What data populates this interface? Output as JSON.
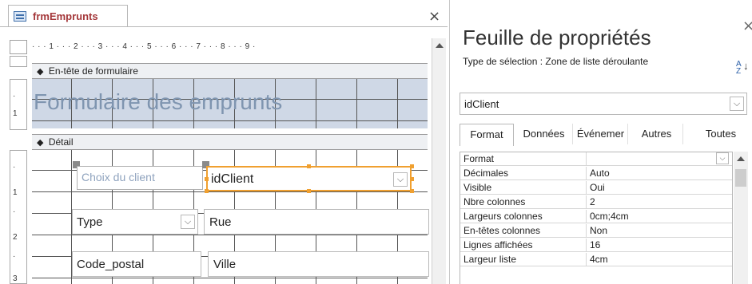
{
  "document": {
    "tab_title": "frmEmprunts",
    "close_symbol": "×"
  },
  "ruler": {
    "marks": "· · · 1 · · · 2 · · · 3 · · · 4 · · · 5 · · · 6 · · · 7 · · · 8 · · · 9 ·"
  },
  "sections": {
    "header_label": "En-tête de formulaire",
    "detail_label": "Détail",
    "arrow": "◆"
  },
  "form": {
    "title": "Formulaire des emprunts",
    "controls": {
      "client_label": "Choix du client",
      "client_combo": "idClient",
      "type": "Type",
      "rue": "Rue",
      "code_postal": "Code_postal",
      "ville": "Ville"
    }
  },
  "vertical_ruler": {
    "marks": [
      "·",
      "1",
      "·",
      "1",
      "·",
      "2",
      "·",
      "3"
    ]
  },
  "property_sheet": {
    "title": "Feuille de propriétés",
    "close_symbol": "×",
    "selection_type": "Type de sélection :  Zone de liste déroulante",
    "sort_icon_top": "A",
    "sort_icon_bottom": "Z",
    "sort_icon_arrow": "↓",
    "selected_object": "idClient",
    "tabs": [
      "Format",
      "Données",
      "Événemer",
      "Autres",
      "Toutes"
    ],
    "properties": [
      {
        "name": "Format",
        "value": ""
      },
      {
        "name": "Décimales",
        "value": "Auto"
      },
      {
        "name": "Visible",
        "value": "Oui"
      },
      {
        "name": "Nbre colonnes",
        "value": "2"
      },
      {
        "name": "Largeurs colonnes",
        "value": "0cm;4cm"
      },
      {
        "name": "En-têtes colonnes",
        "value": "Non"
      },
      {
        "name": "Lignes affichées",
        "value": "16"
      },
      {
        "name": "Largeur liste",
        "value": "4cm"
      }
    ]
  },
  "icons": {
    "dropdown": "chevron-down-icon",
    "sort": "sort-az-icon",
    "form": "form-object-icon"
  },
  "colors": {
    "selection_outline": "#f0a030",
    "header_background": "#cfd8e6",
    "title_text": "#7f95b0",
    "tab_title": "#a4373a"
  }
}
